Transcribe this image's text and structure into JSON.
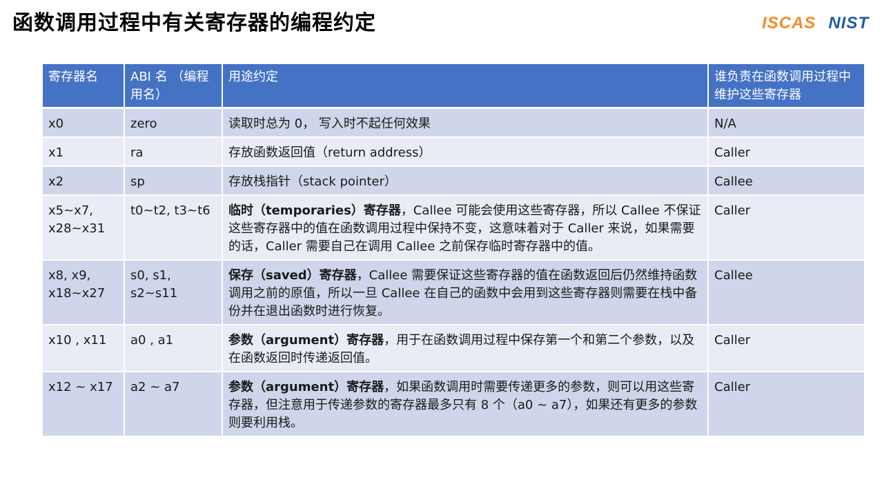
{
  "header": {
    "title": "函数调用过程中有关寄存器的编程约定",
    "logo_left": "ISCAS",
    "logo_right": "NIST"
  },
  "table": {
    "columns": [
      "寄存器名",
      "ABI 名 （编程用名）",
      "用途约定",
      "谁负责在函数调用过程中维护这些寄存器"
    ],
    "rows": [
      {
        "register": "x0",
        "abi": "zero",
        "usage_bold": "",
        "usage": "读取时总为 0， 写入时不起任何效果",
        "maintainer": "N/A"
      },
      {
        "register": "x1",
        "abi": "ra",
        "usage_bold": "",
        "usage": "存放函数返回值（return address）",
        "maintainer": "Caller"
      },
      {
        "register": "x2",
        "abi": "sp",
        "usage_bold": "",
        "usage": "存放栈指针（stack pointer）",
        "maintainer": "Callee"
      },
      {
        "register": "x5~x7, x28~x31",
        "abi": "t0~t2, t3~t6",
        "usage_bold": "临时（temporaries）寄存器",
        "usage": "，Callee 可能会使用这些寄存器，所以 Callee 不保证这些寄存器中的值在函数调用过程中保持不变，这意味着对于 Caller 来说，如果需要的话，Caller 需要自己在调用 Callee 之前保存临时寄存器中的值。",
        "maintainer": "Caller"
      },
      {
        "register": "x8, x9, x18~x27",
        "abi": "s0, s1, s2~s11",
        "usage_bold": "保存（saved）寄存器",
        "usage": "，Callee 需要保证这些寄存器的值在函数返回后仍然维持函数调用之前的原值，所以一旦 Callee 在自己的函数中会用到这些寄存器则需要在栈中备份并在退出函数时进行恢复。",
        "maintainer": "Callee"
      },
      {
        "register": "x10 , x11",
        "abi": "a0 , a1",
        "usage_bold": "参数（argument）寄存器",
        "usage": "，用于在函数调用过程中保存第一个和第二个参数，以及在函数返回时传递返回值。",
        "maintainer": "Caller"
      },
      {
        "register": "x12 ~ x17",
        "abi": "a2 ~ a7",
        "usage_bold": "参数（argument）寄存器",
        "usage": "，如果函数调用时需要传递更多的参数，则可以用这些寄存器，但注意用于传递参数的寄存器最多只有 8 个（a0 ~ a7），如果还有更多的参数则要利用栈。",
        "maintainer": "Caller"
      }
    ]
  },
  "colors": {
    "header_bg": "#4472c4",
    "row_odd": "#cfd5ea",
    "row_even": "#e9ebf5",
    "logo_iscas": "#f08c28",
    "logo_nist": "#1f5ca8"
  }
}
